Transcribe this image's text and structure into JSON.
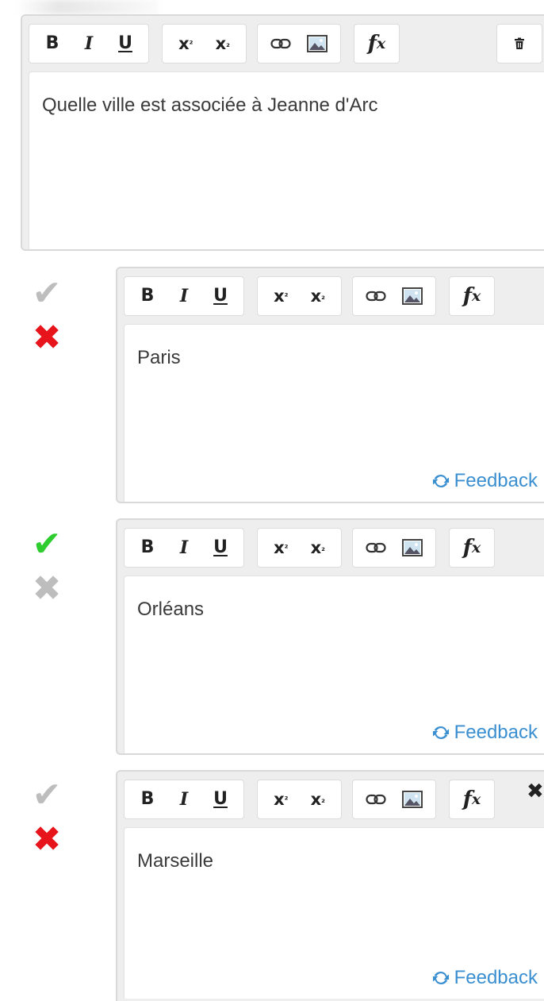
{
  "question": {
    "text": "Quelle ville est associée à Jeanne d'Arc"
  },
  "toolbar": {
    "bold": "B",
    "italic": "I",
    "underline": "U",
    "superscript_base": "x",
    "superscript_exp": "²",
    "subscript_base": "x",
    "subscript_exp": "₂",
    "formula_f": "f",
    "formula_x": "x"
  },
  "answers": [
    {
      "text": "Paris",
      "correct": false,
      "feedback_label": "Feedback"
    },
    {
      "text": "Orléans",
      "correct": true,
      "feedback_label": "Feedback"
    },
    {
      "text": "Marseille",
      "correct": false,
      "feedback_label": "Feedback"
    }
  ],
  "colors": {
    "check_active": "#2ecc2e",
    "check_inactive": "#bdbdbd",
    "cross_active": "#e8141b",
    "cross_inactive": "#bdbdbd",
    "link": "#3a8fd0"
  },
  "icons": {
    "link": "link-icon",
    "image": "image-icon",
    "delete": "trash-icon",
    "refresh": "refresh-icon",
    "check": "checkmark-icon",
    "cross": "cross-icon",
    "close": "close-icon"
  }
}
